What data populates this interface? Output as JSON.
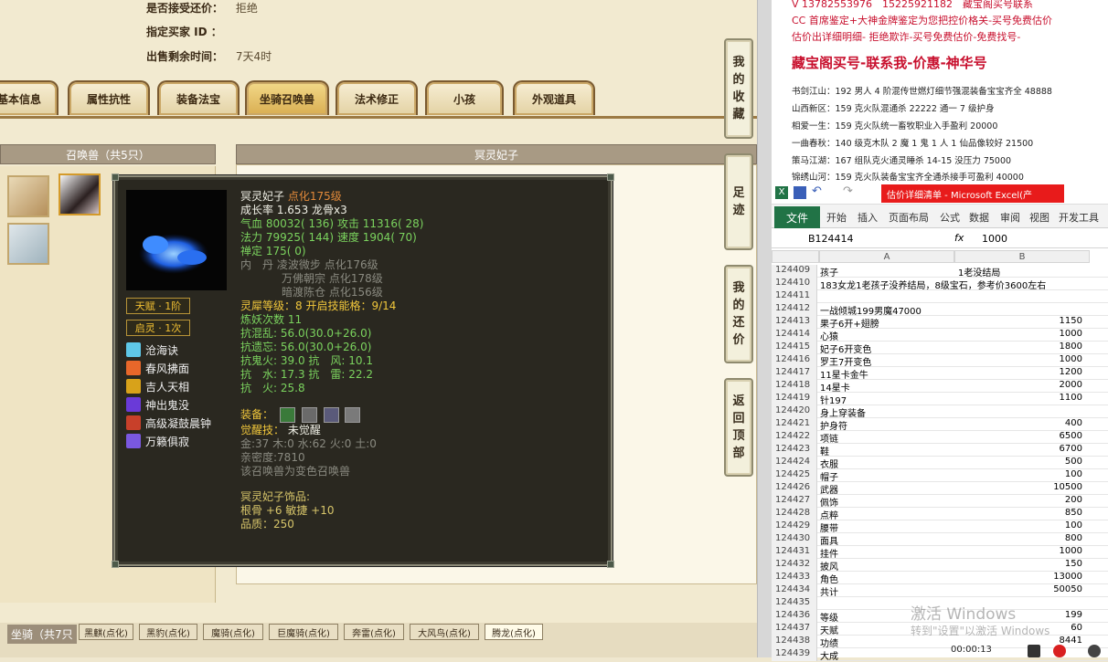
{
  "trade_info": {
    "accept_counter": {
      "label": "是否接受还价：",
      "value": "拒绝"
    },
    "buyer_id": {
      "label": "指定买家 ID ：",
      "value": ""
    },
    "time_left": {
      "label": "出售剩余时间：",
      "value": "7天4时"
    }
  },
  "tabs": [
    "基本信息",
    "属性抗性",
    "装备法宝",
    "坐骑召唤兽",
    "法术修正",
    "小孩",
    "外观道具"
  ],
  "active_tab": "坐骑召唤兽",
  "summons_header": "召唤兽（共5只）",
  "detail_header": "冥灵妃子",
  "tooltip": {
    "name": "冥灵妃子",
    "level": "点化175级",
    "growth_label": "成长率",
    "growth_value": "1.653",
    "bone": "龙骨x3",
    "stats": [
      {
        "k1": "气血",
        "v1": "80032( 136)",
        "k2": "攻击",
        "v2": "11316( 28)"
      },
      {
        "k1": "法力",
        "v1": "79925( 144)",
        "k2": "速度",
        "v2": "1904( 70)"
      },
      {
        "k1": "禅定",
        "v1": "175( 0)",
        "k2": "",
        "v2": ""
      }
    ],
    "dan_label": "内　丹",
    "dan": [
      {
        "name": "凌波微步",
        "lv": "点化176级"
      },
      {
        "name": "万佛朝宗",
        "lv": "点化178级"
      },
      {
        "name": "暗渡陈仓",
        "lv": "点化156级"
      }
    ],
    "lingxi": "灵犀等级：8 开启技能格：9/14",
    "lianyao": "炼妖次数 11",
    "resists": [
      "抗混乱: 56.0(30.0+26.0)",
      "抗遗忘: 56.0(30.0+26.0)",
      "抗鬼火: 39.0 抗　风: 10.1",
      "抗　水: 17.3 抗　雷: 22.2",
      "抗　火: 25.8"
    ],
    "equip_label": "装备：",
    "awaken_label": "觉醒技：",
    "awaken_value": "未觉醒",
    "elements": "金:37 木:0 水:62 火:0 土:0",
    "intimacy": "亲密度:7810",
    "variant": "该召唤兽为变色召唤兽",
    "accessory_title": "冥灵妃子饰品:",
    "accessory_stats": "根骨 +6 敏捷 +10",
    "quality": "品质：250",
    "talent": "天赋 · 1阶",
    "qiling": "启灵 · 1次",
    "skills": [
      "沧海诀",
      "春风拂面",
      "吉人天相",
      "神出鬼没",
      "高级凝鼓晨钟",
      "万籁俱寂"
    ]
  },
  "side_nav": [
    [
      "我",
      "的",
      "收",
      "藏"
    ],
    [
      "足",
      "迹"
    ],
    [
      "我",
      "的",
      "还",
      "价"
    ],
    [
      "返",
      "回",
      "顶",
      "部"
    ]
  ],
  "mounts": {
    "label": "坐骑（共7只",
    "items": [
      "黑麒(点化)",
      "黑豹(点化)",
      "魔骑(点化)",
      "巨魔骑(点化)",
      "奔雷(点化)",
      "大风鸟(点化)",
      "腾龙(点化)"
    ]
  },
  "stream_ads": {
    "line1": "V 13782553976　15225921182　藏宝阁买号联系",
    "line2": "CC 首席鉴定+大神金牌鉴定为您把控价格关-买号免费估价",
    "line3": "估价出详细明细- 拒绝欺诈-买号免费估价-免费找号-",
    "headline": "藏宝阁买号-联系我-价惠-神华号",
    "list": [
      "书剑江山：192 男人 4 阶混传世燃灯细节强混装备宝宝齐全 48888",
      "山西新区：159 克火队混通杀 22222 通一 7 级护身",
      "相爱一生：159 克火队统一畜牧职业入手盈利 20000",
      "一曲春秋：140 级克木队 2 魔 1 鬼 1 人 1 仙品像较好 21500",
      "策马江湖：167 组队克火通灵睡杀 14-15 没压力 75000",
      "锦绣山河：159 克火队装备宝宝齐全通杀接手可盈利 40000"
    ]
  },
  "excel": {
    "title": "估价详细清单 - Microsoft Excel(产",
    "ribbon": [
      "文件",
      "开始",
      "插入",
      "页面布局",
      "公式",
      "数据",
      "审阅",
      "视图",
      "开发工具"
    ],
    "name_box": "B124414",
    "fx": "fx",
    "formula": "1000",
    "columns": [
      "A",
      "B"
    ],
    "rows": [
      {
        "n": "124409",
        "a": "孩子",
        "b": "1老没结局",
        "bl": true
      },
      {
        "n": "124410",
        "a": "183女龙1老孩子没养结局，8级宝石，参考价3600左右",
        "b": "",
        "bl": false
      },
      {
        "n": "124411",
        "a": "",
        "b": "",
        "bl": false
      },
      {
        "n": "124412",
        "a": "一战倾城199男魔47000",
        "b": "",
        "bl": false
      },
      {
        "n": "124413",
        "a": "果子6开+翅膀",
        "b": "1150",
        "bl": false
      },
      {
        "n": "124414",
        "a": "心猿",
        "b": "1000",
        "bl": false
      },
      {
        "n": "124415",
        "a": "妃子6开变色",
        "b": "1800",
        "bl": false
      },
      {
        "n": "124416",
        "a": "罗王7开变色",
        "b": "1000",
        "bl": false
      },
      {
        "n": "124417",
        "a": "11星卡金牛",
        "b": "1200",
        "bl": false
      },
      {
        "n": "124418",
        "a": "14星卡",
        "b": "2000",
        "bl": false
      },
      {
        "n": "124419",
        "a": "针197",
        "b": "1100",
        "bl": false
      },
      {
        "n": "124420",
        "a": "身上穿装备",
        "b": "",
        "bl": false
      },
      {
        "n": "124421",
        "a": "护身符",
        "b": "400",
        "bl": false
      },
      {
        "n": "124422",
        "a": "项链",
        "b": "6500",
        "bl": false
      },
      {
        "n": "124423",
        "a": "鞋",
        "b": "6700",
        "bl": false
      },
      {
        "n": "124424",
        "a": "衣服",
        "b": "500",
        "bl": false
      },
      {
        "n": "124425",
        "a": "帽子",
        "b": "100",
        "bl": false
      },
      {
        "n": "124426",
        "a": "武器",
        "b": "10500",
        "bl": false
      },
      {
        "n": "124427",
        "a": "佩饰",
        "b": "200",
        "bl": false
      },
      {
        "n": "124428",
        "a": "点粹",
        "b": "850",
        "bl": false
      },
      {
        "n": "124429",
        "a": "腰带",
        "b": "100",
        "bl": false
      },
      {
        "n": "124430",
        "a": "面具",
        "b": "800",
        "bl": false
      },
      {
        "n": "124431",
        "a": "挂件",
        "b": "1000",
        "bl": false
      },
      {
        "n": "124432",
        "a": "披风",
        "b": "150",
        "bl": false
      },
      {
        "n": "124433",
        "a": "角色",
        "b": "13000",
        "bl": false
      },
      {
        "n": "124434",
        "a": "共计",
        "b": "50050",
        "bl": false
      },
      {
        "n": "124435",
        "a": "",
        "b": "",
        "bl": false
      },
      {
        "n": "124436",
        "a": "等级",
        "b": "199",
        "bl": false
      },
      {
        "n": "124437",
        "a": "天赋",
        "b": "60",
        "bl": false
      },
      {
        "n": "124438",
        "a": "功绩",
        "b": "8441",
        "bl": false
      },
      {
        "n": "124439",
        "a": "大成",
        "b": "",
        "bl": false
      }
    ]
  },
  "watermark": {
    "line1": "激活 Windows",
    "line2": "转到\"设置\"以激活 Windows"
  },
  "player_time": "00:00:13"
}
